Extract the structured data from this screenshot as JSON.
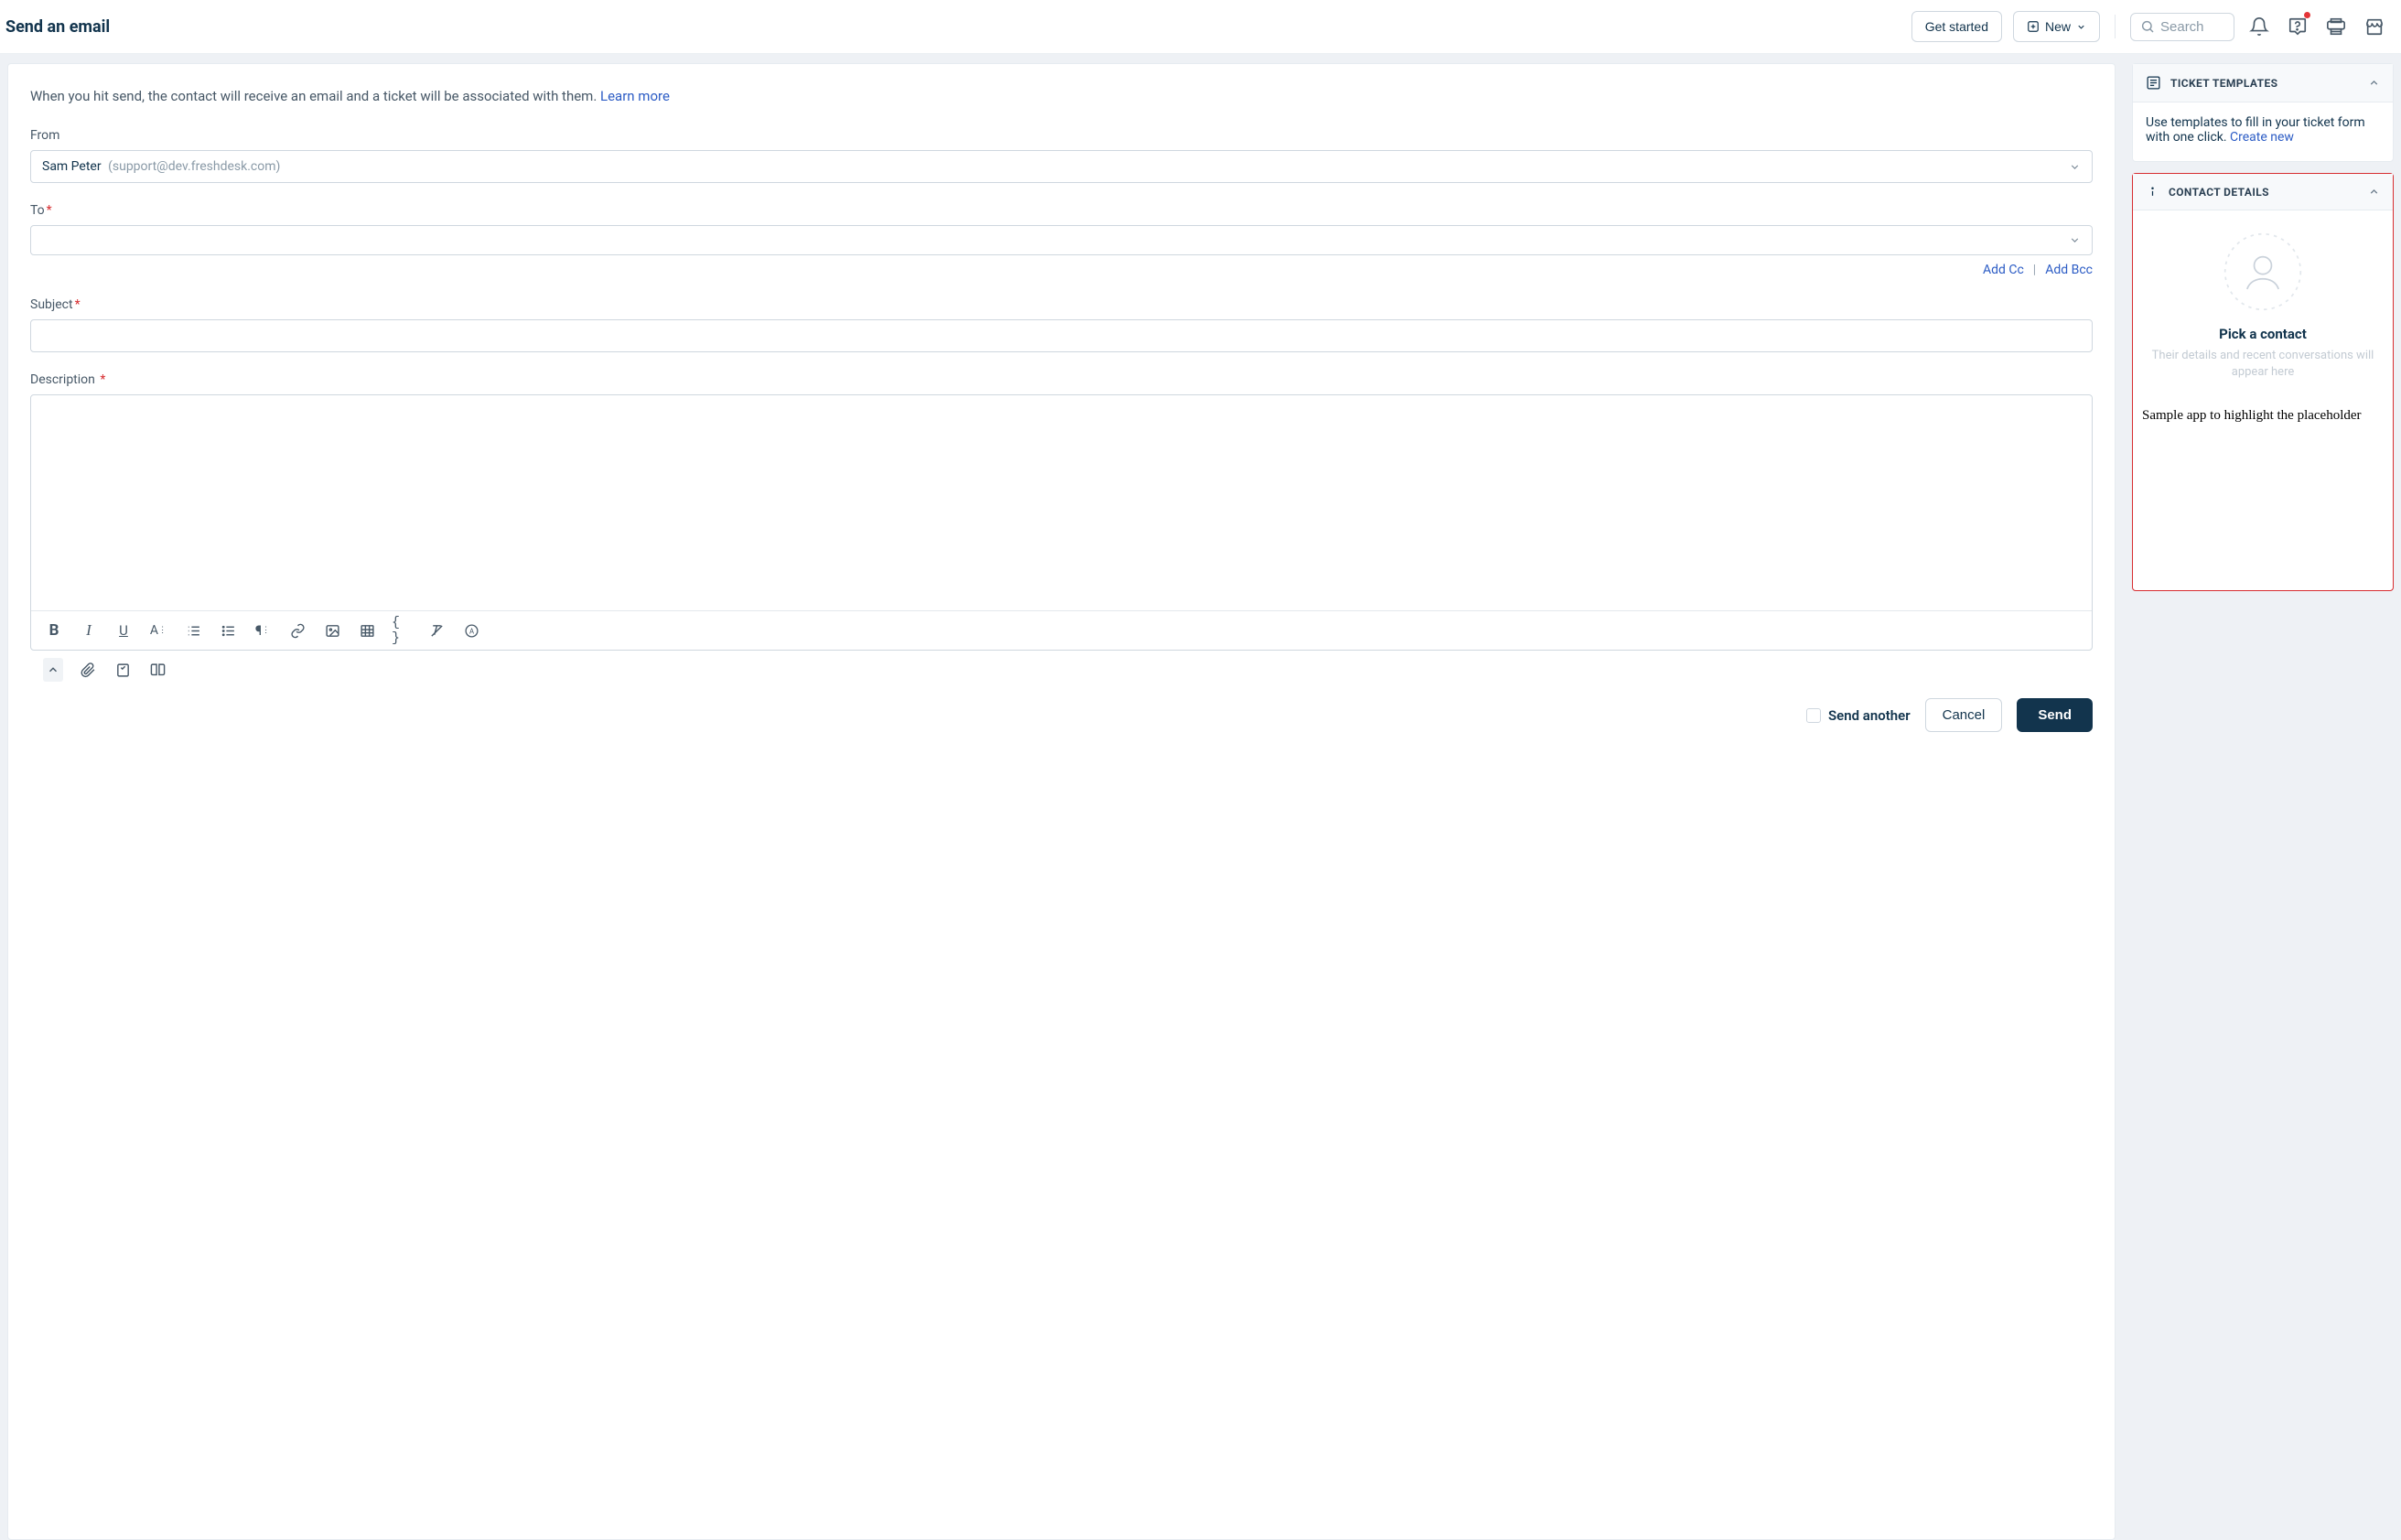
{
  "header": {
    "title": "Send an email",
    "get_started": "Get started",
    "new_label": "New",
    "search_placeholder": "Search"
  },
  "main": {
    "intro_text": "When you hit send, the contact will receive an email and a ticket will be associated with them. ",
    "learn_more": "Learn more",
    "from_label": "From",
    "from_name": "Sam Peter",
    "from_email": "(support@dev.freshdesk.com)",
    "to_label": "To",
    "add_cc": "Add Cc",
    "cc_sep": "|",
    "add_bcc": "Add Bcc",
    "subject_label": "Subject",
    "description_label": "Description"
  },
  "footer": {
    "send_another": "Send another",
    "cancel": "Cancel",
    "send": "Send"
  },
  "sidebar": {
    "templates": {
      "title": "TICKET TEMPLATES",
      "body_text": "Use templates to fill in your ticket form with one click. ",
      "create_new": "Create new"
    },
    "contact": {
      "title": "CONTACT DETAILS",
      "pick_title": "Pick a contact",
      "pick_sub": "Their details and recent conversations will appear here",
      "sample_note": "Sample app to highlight the placeholder"
    }
  }
}
